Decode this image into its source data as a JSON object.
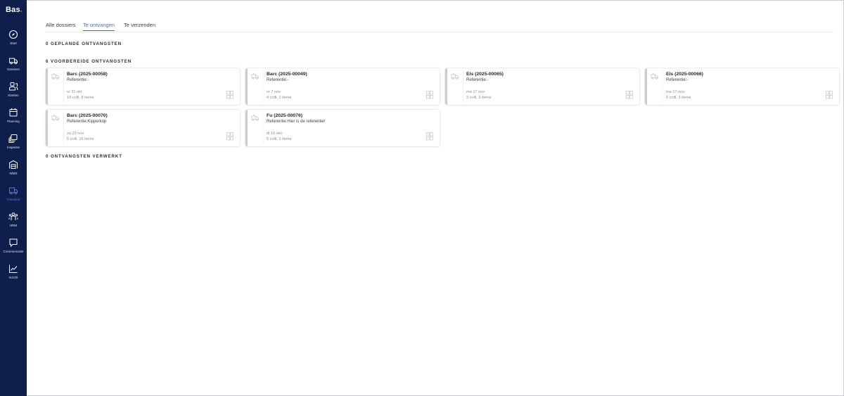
{
  "app": {
    "logo_text": "Bas",
    "logo_dot": "."
  },
  "sidebar": {
    "items": [
      {
        "label": "Start",
        "icon": "compass-icon",
        "active": false
      },
      {
        "label": "Dossiers",
        "icon": "truck-icon",
        "active": false
      },
      {
        "label": "Klanten",
        "icon": "users-icon",
        "active": false
      },
      {
        "label": "Planning",
        "icon": "calendar-icon",
        "active": false
      },
      {
        "label": "Inspectie",
        "icon": "layers-icon",
        "active": false
      },
      {
        "label": "WMS",
        "icon": "warehouse-icon",
        "active": false
      },
      {
        "label": "Transport",
        "icon": "transport-icon",
        "active": true
      },
      {
        "label": "HRM",
        "icon": "people-icon",
        "active": false
      },
      {
        "label": "Communicatie",
        "icon": "chat-icon",
        "active": false
      },
      {
        "label": "Inzicht",
        "icon": "chart-icon",
        "active": false
      }
    ]
  },
  "tabs": [
    {
      "label": "Alle dossiers",
      "active": false
    },
    {
      "label": "Te ontvangen",
      "active": true
    },
    {
      "label": "Te verzenden",
      "active": false
    }
  ],
  "sections": {
    "planned": "0 GEPLANDE ONTVANGSTEN",
    "prepared": "6 VOORBEREIDE ONTVANGSTEN",
    "processed": "0 ONTVANGSTEN VERWERKT"
  },
  "cards": [
    {
      "title": "Barc (2025-00058)",
      "reference": "Referentie:-",
      "date": "vr 31 okt",
      "meta": "10 colli, 8 items"
    },
    {
      "title": "Barc (2025-00049)",
      "reference": "Referentie:-",
      "date": "vr 7 nov",
      "meta": "4 colli, 2 items"
    },
    {
      "title": "Els (2025-00065)",
      "reference": "Referentie:-",
      "date": "ma 17 nov",
      "meta": "3 colli, 2 items"
    },
    {
      "title": "Els (2025-00066)",
      "reference": "Referentie:-",
      "date": "ma 17 nov",
      "meta": "5 colli, 3 items"
    },
    {
      "title": "Barc (2025-00070)",
      "reference": "Referentie:Kipperkop",
      "date": "za 29 nov",
      "meta": "5 colli, 16 items"
    },
    {
      "title": "Fu (2025-00076)",
      "reference": "Referentie:Hier is de referentie!",
      "date": "di 16 dec",
      "meta": "5 colli, 2 items"
    }
  ],
  "colors": {
    "sidebar": "#0f1f4b",
    "accent": "#3a6fd8",
    "card_bar": "#c9ccd3"
  }
}
